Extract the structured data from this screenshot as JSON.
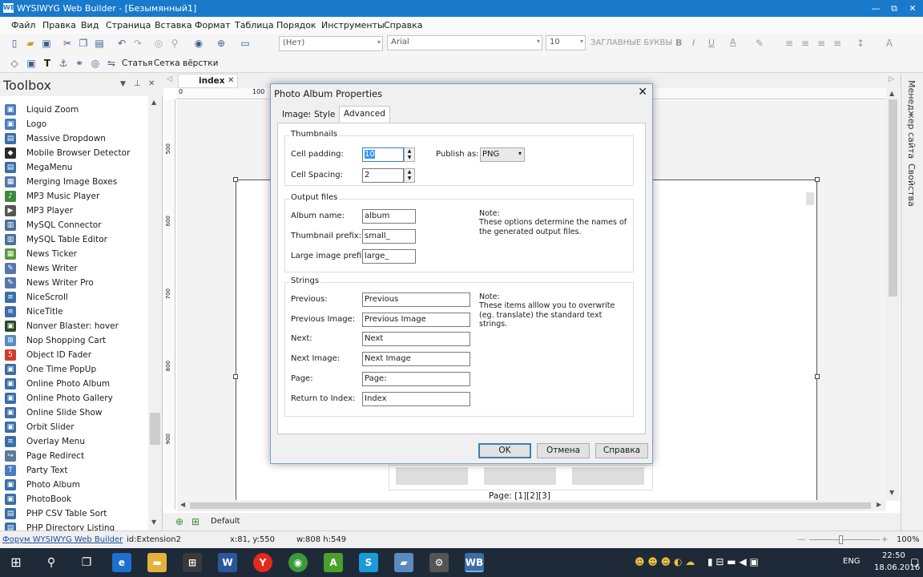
{
  "window": {
    "title": "WYSIWYG Web Builder - [Безымянный1]",
    "app_icon": "WB",
    "minimize": "—",
    "restore": "⧉",
    "close": "✕"
  },
  "menu": [
    "Файл",
    "Правка",
    "Вид",
    "Страница",
    "Вставка",
    "Формат",
    "Таблица",
    "Порядок",
    "Инструменты",
    "Справка"
  ],
  "toolbar": {
    "style_combo": "(Нет)",
    "font_combo": "Arial",
    "size_combo": "10",
    "caps_label": "ЗАГЛАВНЫЕ БУКВЫ",
    "bold": "B",
    "italic": "I",
    "underline": "U",
    "font_color_icon": "A",
    "article_label": "Статья",
    "grid_label": "Сетка вёрстки"
  },
  "toolbox": {
    "title": "Toolbox",
    "items": [
      {
        "label": "Liquid Zoom",
        "color": "#4a7bbf",
        "glyph": "▣"
      },
      {
        "label": "Logo",
        "color": "#4a7bbf",
        "glyph": "▣"
      },
      {
        "label": "Massive Dropdown",
        "color": "#3a6ea5",
        "glyph": "▤"
      },
      {
        "label": "Mobile Browser Detector",
        "color": "#2a2a2a",
        "glyph": "◆"
      },
      {
        "label": "MegaMenu",
        "color": "#3a6ea5",
        "glyph": "▤"
      },
      {
        "label": "Merging Image Boxes",
        "color": "#5577aa",
        "glyph": "▦"
      },
      {
        "label": "MP3 Music Player",
        "color": "#3b8a3b",
        "glyph": "♪"
      },
      {
        "label": "MP3 Player",
        "color": "#555555",
        "glyph": "▶"
      },
      {
        "label": "MySQL Connector",
        "color": "#4a6f9a",
        "glyph": "▥"
      },
      {
        "label": "MySQL Table Editor",
        "color": "#4a6f9a",
        "glyph": "▥"
      },
      {
        "label": "News Ticker",
        "color": "#5a9a3a",
        "glyph": "▦"
      },
      {
        "label": "News Writer",
        "color": "#5577aa",
        "glyph": "✎"
      },
      {
        "label": "News Writer Pro",
        "color": "#5577aa",
        "glyph": "✎"
      },
      {
        "label": "NiceScroll",
        "color": "#3a6ea5",
        "glyph": "≡"
      },
      {
        "label": "NiceTitle",
        "color": "#3a6ea5",
        "glyph": "≡"
      },
      {
        "label": "Nonver Blaster: hover",
        "color": "#2a4a2a",
        "glyph": "▣"
      },
      {
        "label": "Nop Shopping Cart",
        "color": "#5a8ac0",
        "glyph": "⊞"
      },
      {
        "label": "Object ID Fader",
        "color": "#d23a2a",
        "glyph": "5"
      },
      {
        "label": "One Time PopUp",
        "color": "#3a6ea5",
        "glyph": "▣"
      },
      {
        "label": "Online Photo Album",
        "color": "#3a6ea5",
        "glyph": "▣"
      },
      {
        "label": "Online Photo Gallery",
        "color": "#3a6ea5",
        "glyph": "▣"
      },
      {
        "label": "Online Slide Show",
        "color": "#3a6ea5",
        "glyph": "▣"
      },
      {
        "label": "Orbit Slider",
        "color": "#3a6ea5",
        "glyph": "▣"
      },
      {
        "label": "Overlay Menu",
        "color": "#3a6ea5",
        "glyph": "≡"
      },
      {
        "label": "Page Redirect",
        "color": "#5a7a9a",
        "glyph": "↪"
      },
      {
        "label": "Party Text",
        "color": "#4a7bbf",
        "glyph": "T"
      },
      {
        "label": "Photo Album",
        "color": "#3a6ea5",
        "glyph": "▣"
      },
      {
        "label": "PhotoBook",
        "color": "#3a6ea5",
        "glyph": "▣"
      },
      {
        "label": "PHP CSV Table Sort",
        "color": "#3a6ea5",
        "glyph": "▤"
      },
      {
        "label": "PHP Directory Listing",
        "color": "#3a6ea5",
        "glyph": "▤"
      }
    ]
  },
  "editor": {
    "tab": "index",
    "ruler_h": [
      "0",
      "100"
    ],
    "ruler_v": [
      "500",
      "600",
      "700",
      "800",
      "900"
    ],
    "page_caption": "Page: [1][2][3]",
    "default_label": "Default"
  },
  "right_panel": {
    "site_manager": "Менеджер сайта",
    "properties": "Свойства"
  },
  "status": {
    "forum_link": "Форум WYSIWYG Web Builder",
    "id": "id:Extension2",
    "coords": "x:81, y:550",
    "size": "w:808 h:549",
    "zoom": "100%"
  },
  "taskbar": {
    "lang": "ENG",
    "time": "22:50",
    "date": "18.06.2016"
  },
  "dialog": {
    "title": "Photo Album Properties",
    "tabs": [
      "Images",
      "Style",
      "Advanced"
    ],
    "thumbnails": {
      "group": "Thumbnails",
      "cell_padding_label": "Cell padding:",
      "cell_padding": "10",
      "cell_spacing_label": "Cell Spacing:",
      "cell_spacing": "2",
      "publish_label": "Publish as:",
      "publish_value": "PNG"
    },
    "output": {
      "group": "Output files",
      "album_label": "Album name:",
      "album": "album",
      "thumb_label": "Thumbnail prefix:",
      "thumb": "small_",
      "large_label": "Large image prefix:",
      "large": "large_",
      "note_title": "Note:",
      "note": "These options determine the names of the generated output files."
    },
    "strings": {
      "group": "Strings",
      "note_title": "Note:",
      "note": "These items alllow you to overwrite (eg. translate) the standard text strings.",
      "rows": [
        {
          "label": "Previous:",
          "value": "Previous"
        },
        {
          "label": "Previous Image:",
          "value": "Previous Image"
        },
        {
          "label": "Next:",
          "value": "Next"
        },
        {
          "label": "Next Image:",
          "value": "Next Image"
        },
        {
          "label": "Page:",
          "value": "Page:"
        },
        {
          "label": "Return to Index:",
          "value": "Index"
        }
      ]
    },
    "buttons": {
      "ok": "OK",
      "cancel": "Отмена",
      "help": "Справка"
    }
  }
}
